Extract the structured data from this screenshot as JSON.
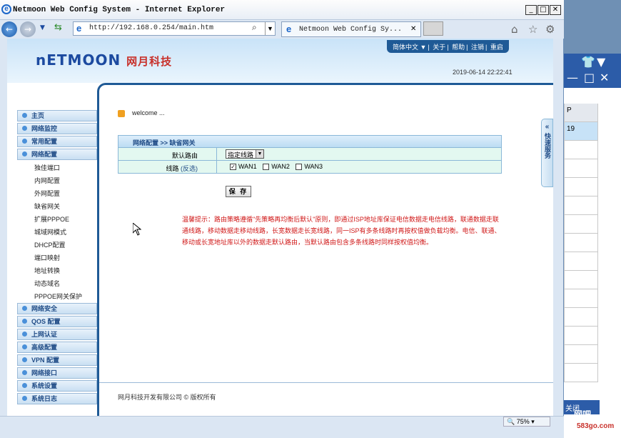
{
  "browser": {
    "title": "Netmoon Web Config System - Internet Explorer",
    "address": "http://192.168.0.254/main.htm",
    "tab_title": "Netmoon Web Config Sy...",
    "zoom": "75%"
  },
  "header": {
    "logo_text": "nETMOON",
    "logo_cn": "网月科技",
    "top_menu": [
      "简体中文 ▼",
      "关于",
      "帮助",
      "注销",
      "重启"
    ],
    "datetime": "2019-06-14 22:22:41"
  },
  "sidebar": {
    "groups_top": [
      "主页",
      "网络监控",
      "常用配置",
      "网络配置"
    ],
    "sub_items": [
      "独佳端口",
      "内网配置",
      "外网配置",
      "缺省网关",
      "扩展PPPOE",
      "城域网模式",
      "DHCP配置",
      "端口映射",
      "地址转换",
      "动态域名",
      "PPPOE网关保护"
    ],
    "groups_bottom": [
      "网络安全",
      "QOS 配置",
      "上网认证",
      "高级配置",
      "VPN 配置",
      "网络接口",
      "系统设置",
      "系统日志"
    ]
  },
  "content": {
    "welcome": "welcome ...",
    "breadcrumb": "网络配置 >> 缺省网关",
    "default_route_label": "默认路由",
    "default_route_value": "指定线路",
    "line_label": "线路",
    "invert_link": "(反选)",
    "lines": [
      {
        "label": "WAN1",
        "checked": true
      },
      {
        "label": "WAN2",
        "checked": false
      },
      {
        "label": "WAN3",
        "checked": false
      }
    ],
    "save_label": "保 存",
    "hint": "温馨提示：路由策略遵循\"先策略再均衡后默认\"原则，即通过ISP地址库保证电信数据走电信线路，联通数据走联通线路，移动数据走移动线路，长宽数据走长宽线路，同一ISP有多条线路时再按权值做负载均衡。电信、联通、移动或长宽地址库以外的数据走默认路由，当默认路由包含多条线路时同样按权值均衡。",
    "footer": "网月科技开发有限公司 © 版权所有"
  },
  "quick_service": "快速服务",
  "background_window": {
    "cell_header": "P",
    "cell_value": "19",
    "close_label": "关闭",
    "watermark": "网吧",
    "watermark_url": "583go.com"
  },
  "colors": {
    "accent": "#1f5a96",
    "hint": "#d01818",
    "logo_red": "#c8302a"
  }
}
